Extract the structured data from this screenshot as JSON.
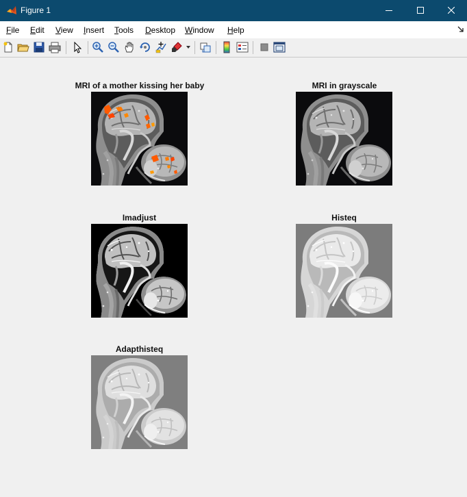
{
  "window": {
    "title": "Figure 1",
    "controls": [
      "minimize",
      "maximize",
      "close"
    ]
  },
  "menubar": {
    "items": [
      {
        "mnemonic": "F",
        "rest": "ile"
      },
      {
        "mnemonic": "E",
        "rest": "dit"
      },
      {
        "mnemonic": "V",
        "rest": "iew"
      },
      {
        "mnemonic": "I",
        "rest": "nsert"
      },
      {
        "mnemonic": "T",
        "rest": "ools"
      },
      {
        "mnemonic": "D",
        "rest": "esktop"
      },
      {
        "mnemonic": "W",
        "rest": "indow"
      },
      {
        "mnemonic": "H",
        "rest": "elp"
      }
    ]
  },
  "toolbar": {
    "icons": [
      "new-figure-icon",
      "open-file-icon",
      "save-icon",
      "print-icon",
      "pointer-icon",
      "zoom-in-icon",
      "zoom-out-icon",
      "pan-icon",
      "rotate-3d-icon",
      "data-cursor-icon",
      "brush-icon",
      "link-plot-icon",
      "colorbar-icon",
      "legend-icon",
      "hide-plot-tools-icon",
      "show-plot-tools-icon"
    ]
  },
  "accent_colors": {
    "titlebar": "#0c4a6e",
    "activation": "#ff5a00"
  },
  "subplots": [
    {
      "title": "MRI of a mother kissing her baby",
      "variant": "color"
    },
    {
      "title": "MRI in grayscale",
      "variant": "gray"
    },
    {
      "title": "Imadjust",
      "variant": "imadjust"
    },
    {
      "title": "Histeq",
      "variant": "histeq"
    },
    {
      "title": "Adapthisteq",
      "variant": "adapthisteq"
    }
  ]
}
